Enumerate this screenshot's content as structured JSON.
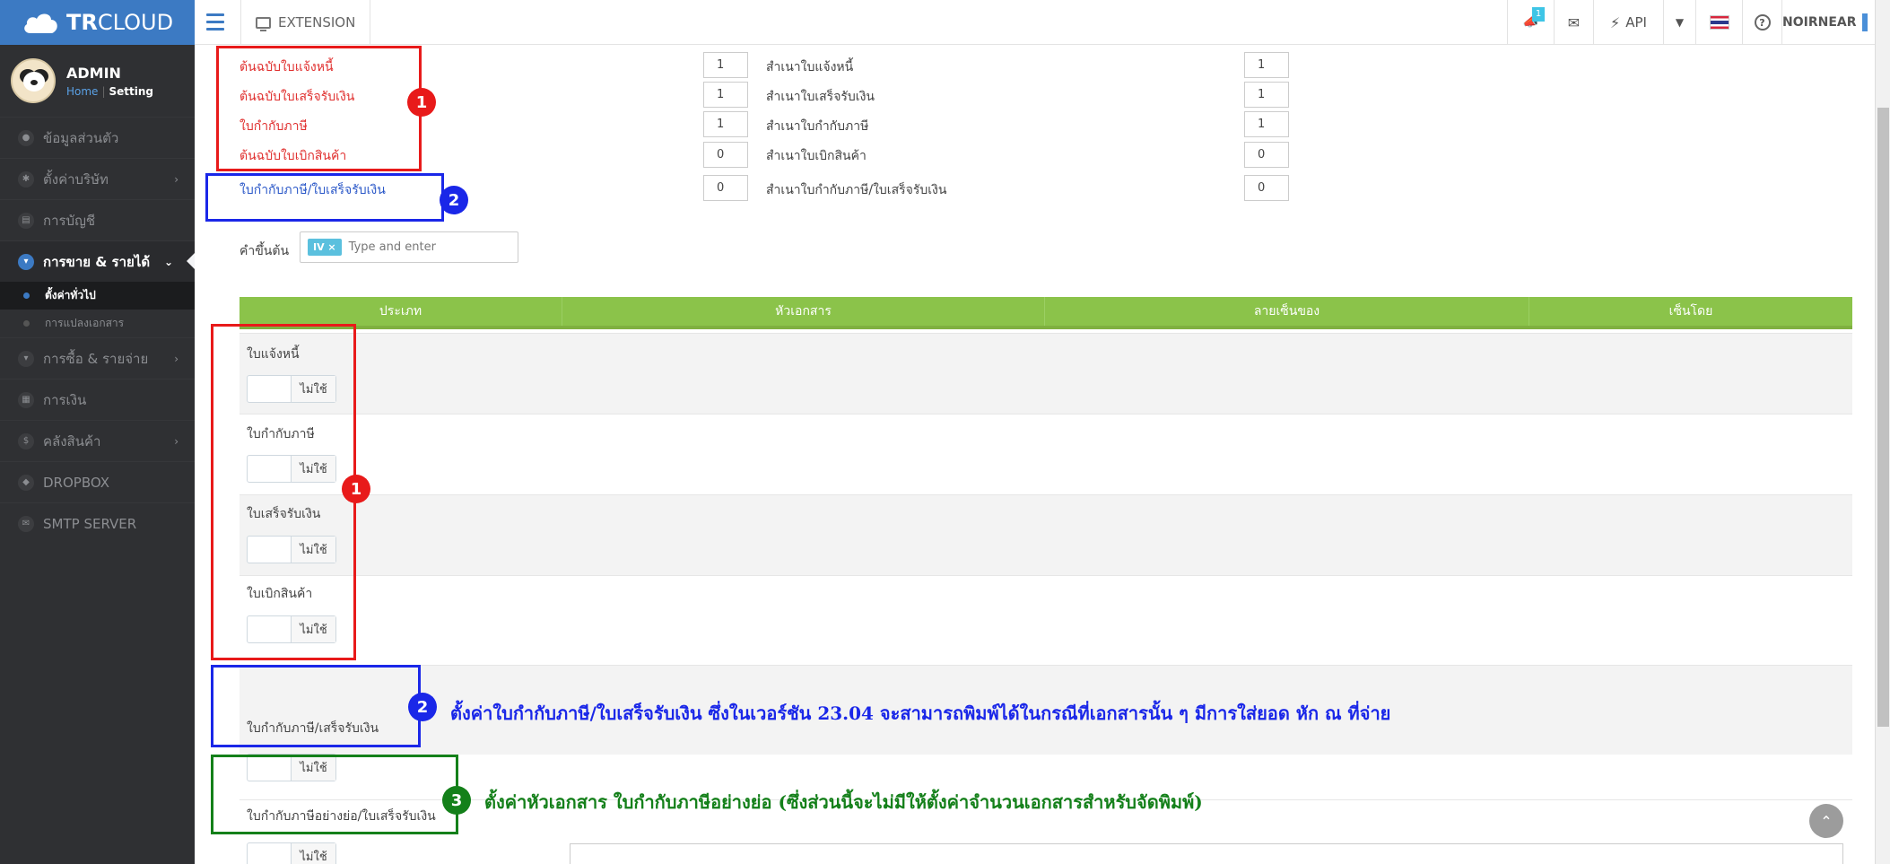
{
  "brand": {
    "bold": "TR",
    "rest": "CLOUD"
  },
  "topbar": {
    "extension_label": "EXTENSION",
    "notify_badge": "1",
    "api_label": "API",
    "user_name": "NOIRNEAR"
  },
  "sidebar": {
    "profile_name": "ADMIN",
    "home_link": "Home",
    "setting_link": "Setting",
    "items": [
      {
        "label": "ข้อมูลส่วนตัว",
        "icon": "person-icon"
      },
      {
        "label": "ตั้งค่าบริษัท",
        "icon": "gear-icon"
      },
      {
        "label": "การบัญชี",
        "icon": "book-icon"
      },
      {
        "label": "การขาย & รายได้",
        "icon": "cart-icon"
      },
      {
        "label": "การซื้อ & รายจ่าย",
        "icon": "cart-icon"
      },
      {
        "label": "การเงิน",
        "icon": "calendar-icon"
      },
      {
        "label": "คลังสินค้า",
        "icon": "dollar-icon"
      },
      {
        "label": "DROPBOX",
        "icon": "dropbox-icon"
      },
      {
        "label": "SMTP SERVER",
        "icon": "mail-icon"
      }
    ],
    "sub_items": [
      {
        "label": "ตั้งค่าทั่วไป"
      },
      {
        "label": "การแปลงเอกสาร"
      }
    ]
  },
  "form": {
    "rows": [
      {
        "label": "ต้นฉบับใบแจ้งหนี้",
        "original": "1",
        "copy_label": "สำเนาใบแจ้งหนี้",
        "copy": "1"
      },
      {
        "label": "ต้นฉบับใบเสร็จรับเงิน",
        "original": "1",
        "copy_label": "สำเนาใบเสร็จรับเงิน",
        "copy": "1"
      },
      {
        "label": "ใบกำกับภาษี",
        "original": "1",
        "copy_label": "สำเนาใบกำกับภาษี",
        "copy": "1"
      },
      {
        "label": "ต้นฉบับใบเบิกสินค้า",
        "original": "0",
        "copy_label": "สำเนาใบเบิกสินค้า",
        "copy": "0"
      },
      {
        "label": "ใบกำกับภาษี/ใบเสร็จรับเงิน",
        "original": "0",
        "copy_label": "สำเนาใบกำกับภาษี/ใบเสร็จรับเงิน",
        "copy": "0"
      }
    ],
    "prefix_label": "คำขึ้นต้น",
    "prefix_tag": "IV ×",
    "prefix_placeholder": "Type and enter"
  },
  "grid": {
    "headers": [
      "ประเภท",
      "หัวเอกสาร",
      "ลายเซ็นของ",
      "เซ็นโดย"
    ],
    "rows": [
      {
        "label": "ใบแจ้งหนี้",
        "toggle": "ไม่ใช้"
      },
      {
        "label": "ใบกำกับภาษี",
        "toggle": "ไม่ใช้"
      },
      {
        "label": "ใบเสร็จรับเงิน",
        "toggle": "ไม่ใช้"
      },
      {
        "label": "ใบเบิกสินค้า",
        "toggle": "ไม่ใช้"
      },
      {
        "label": "ใบกำกับภาษี/เสร็จรับเงิน",
        "toggle": "ไม่ใช้"
      },
      {
        "label": "ใบกำกับภาษีอย่างย่อ/ใบเสร็จรับเงิน",
        "toggle": "ไม่ใช้"
      }
    ]
  },
  "annotations": {
    "n1": "1",
    "n2": "2",
    "n3": "3",
    "note2": "ตั้งค่าใบกำกับภาษี/ใบเสร็จรับเงิน ซึ่งในเวอร์ชัน 23.04 จะสามารถพิมพ์ได้ในกรณีที่เอกสารนั้น ๆ มีการใส่ยอด หัก ณ ที่จ่าย",
    "note3": "ตั้งค่าหัวเอกสาร ใบกำกับภาษีอย่างย่อ (ซึ่งส่วนนี้จะไม่มีให้ตั้งค่าจำนวนเอกสารสำหรับจัดพิมพ์)"
  },
  "colors": {
    "brand": "#3c7ac3",
    "grid_header": "#8bc34a",
    "annotation_red": "#e81a1a",
    "annotation_blue": "#1a27e8",
    "annotation_green": "#14801a"
  }
}
